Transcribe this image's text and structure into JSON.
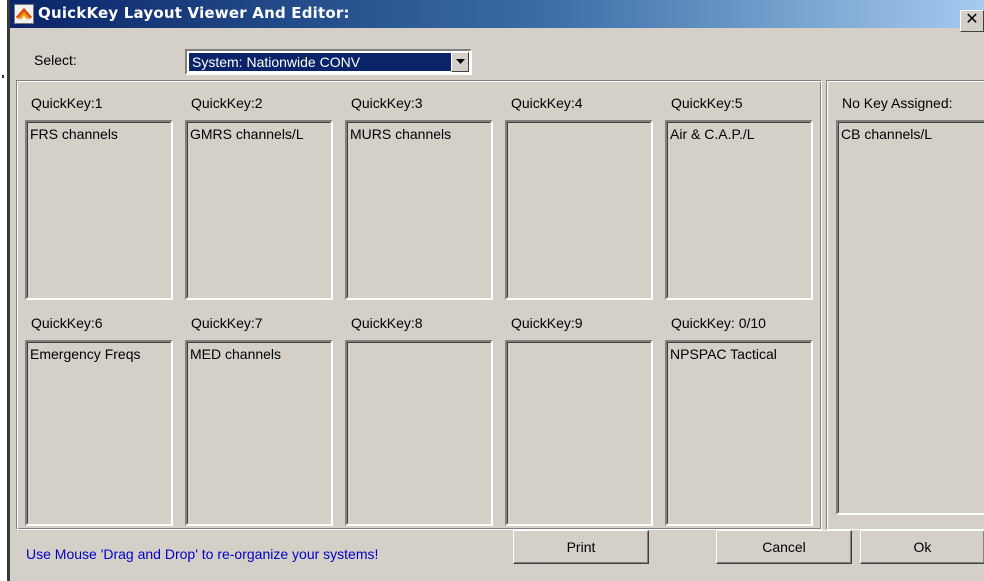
{
  "window": {
    "title": "QuickKey Layout Viewer And Editor:",
    "close_label": "✕"
  },
  "select": {
    "label": "Select:",
    "value": "System: Nationwide CONV"
  },
  "quickkeys": [
    {
      "label": "QuickKey:1",
      "items": [
        "FRS channels"
      ]
    },
    {
      "label": "QuickKey:2",
      "items": [
        "GMRS channels/L"
      ]
    },
    {
      "label": "QuickKey:3",
      "items": [
        "MURS channels"
      ]
    },
    {
      "label": "QuickKey:4",
      "items": [
        ""
      ]
    },
    {
      "label": "QuickKey:5",
      "items": [
        "Air & C.A.P./L"
      ]
    },
    {
      "label": "QuickKey:6",
      "items": [
        "Emergency Freqs"
      ]
    },
    {
      "label": "QuickKey:7",
      "items": [
        "MED channels"
      ]
    },
    {
      "label": "QuickKey:8",
      "items": [
        ""
      ]
    },
    {
      "label": "QuickKey:9",
      "items": [
        ""
      ]
    },
    {
      "label": "QuickKey: 0/10",
      "items": [
        "NPSPAC Tactical"
      ]
    }
  ],
  "unassigned": {
    "label": "No Key Assigned:",
    "items": [
      "CB channels/L"
    ]
  },
  "footer": {
    "hint": "Use Mouse 'Drag and Drop' to re-organize your systems!",
    "print_label": "Print",
    "cancel_label": "Cancel",
    "ok_label": "Ok"
  },
  "colors": {
    "title_gradient_start": "#0a246a",
    "title_gradient_end": "#a6caf0",
    "face": "#d4d0c8",
    "hint_text": "#0000c8",
    "selection": "#0a246a"
  }
}
